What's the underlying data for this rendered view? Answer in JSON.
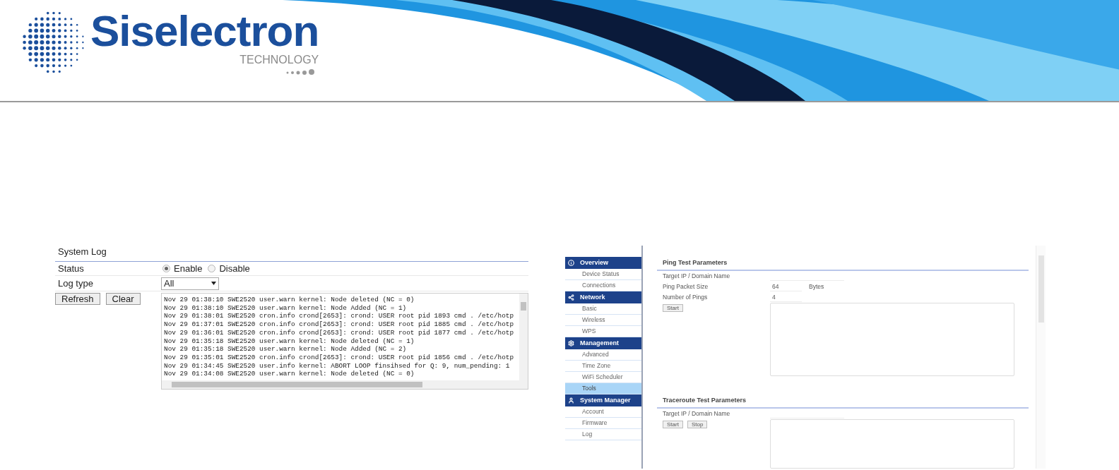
{
  "banner": {
    "brand": "Siselectron",
    "tagline": "TECHNOLOGY"
  },
  "system_log": {
    "title": "System Log",
    "status": {
      "label": "Status",
      "options": [
        {
          "label": "Enable",
          "selected": true
        },
        {
          "label": "Disable",
          "selected": false
        }
      ]
    },
    "log_type": {
      "label": "Log type",
      "value": "All"
    },
    "buttons": [
      "Refresh",
      "Clear"
    ],
    "log_lines": [
      "Nov 29 01:38:10 SWE2520 user.warn kernel: Node deleted (NC = 0)",
      "Nov 29 01:38:10 SWE2520 user.warn kernel: Node Added (NC = 1)",
      "Nov 29 01:38:01 SWE2520 cron.info crond[2653]: crond: USER root pid 1893 cmd . /etc/hotp",
      "Nov 29 01:37:01 SWE2520 cron.info crond[2653]: crond: USER root pid 1885 cmd . /etc/hotp",
      "Nov 29 01:36:01 SWE2520 cron.info crond[2653]: crond: USER root pid 1877 cmd . /etc/hotp",
      "Nov 29 01:35:18 SWE2520 user.warn kernel: Node deleted (NC = 1)",
      "Nov 29 01:35:18 SWE2520 user.warn kernel: Node Added (NC = 2)",
      "Nov 29 01:35:01 SWE2520 cron.info crond[2653]: crond: USER root pid 1856 cmd . /etc/hotp",
      "Nov 29 01:34:45 SWE2520 user.info kernel: ABORT LOOP finsihsed for Q: 9, num_pending: 1",
      "Nov 29 01:34:08 SWE2520 user.warn kernel: Node deleted (NC = 0)"
    ]
  },
  "tools": {
    "sidebar": [
      {
        "label": "Overview",
        "children": [
          {
            "label": "Device Status",
            "selected": false
          },
          {
            "label": "Connections",
            "selected": false
          }
        ]
      },
      {
        "label": "Network",
        "children": [
          {
            "label": "Basic",
            "selected": false
          },
          {
            "label": "Wireless",
            "selected": false
          },
          {
            "label": "WPS",
            "selected": false
          }
        ]
      },
      {
        "label": "Management",
        "children": [
          {
            "label": "Advanced",
            "selected": false
          },
          {
            "label": "Time Zone",
            "selected": false
          },
          {
            "label": "WiFi Scheduler",
            "selected": false
          },
          {
            "label": "Tools",
            "selected": true
          }
        ]
      },
      {
        "label": "System Manager",
        "children": [
          {
            "label": "Account",
            "selected": false
          },
          {
            "label": "Firmware",
            "selected": false
          },
          {
            "label": "Log",
            "selected": false
          }
        ]
      }
    ],
    "ping": {
      "title": "Ping Test Parameters",
      "fields": [
        {
          "label": "Target IP / Domain Name"
        },
        {
          "label": "Ping Packet Size",
          "value": "64",
          "unit": "Bytes"
        },
        {
          "label": "Number of Pings",
          "value": "4"
        }
      ],
      "buttons": [
        "Start"
      ]
    },
    "traceroute": {
      "title": "Traceroute Test Parameters",
      "fields": [
        {
          "label": "Target IP / Domain Name"
        }
      ],
      "buttons": [
        "Start",
        "Stop"
      ]
    }
  }
}
